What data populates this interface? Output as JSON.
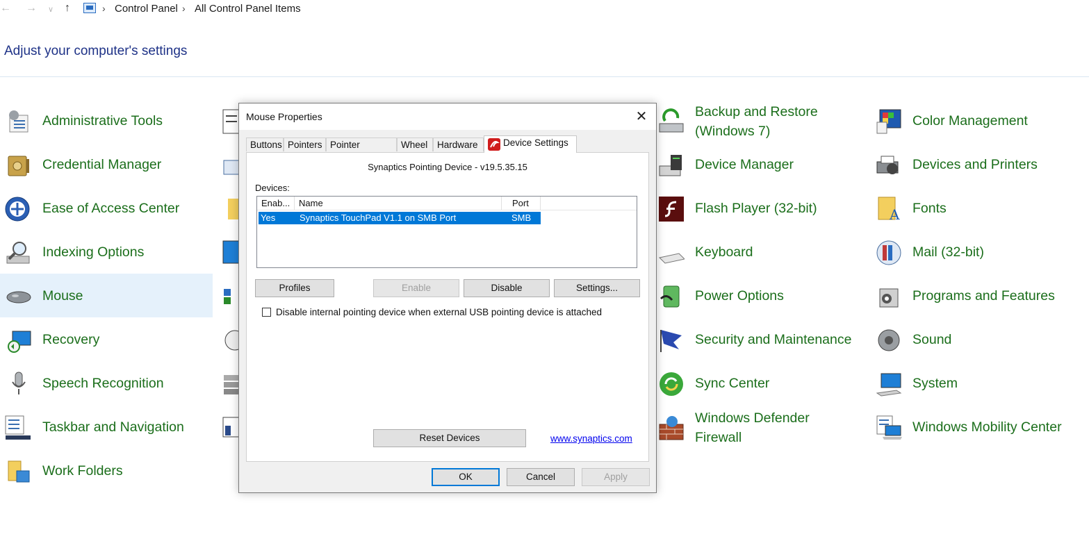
{
  "address": {
    "back": "←",
    "forward": "→",
    "recent": "∨",
    "up": "↑",
    "breadcrumb": [
      "Control Panel",
      "All Control Panel Items"
    ],
    "separator": "›"
  },
  "heading": "Adjust your computer's settings",
  "items": {
    "col1": [
      {
        "label": "Administrative Tools",
        "icon": "admin-tools-icon"
      },
      {
        "label": "Credential Manager",
        "icon": "credential-manager-icon"
      },
      {
        "label": "Ease of Access Center",
        "icon": "ease-of-access-icon"
      },
      {
        "label": "Indexing Options",
        "icon": "indexing-options-icon"
      },
      {
        "label": "Mouse",
        "icon": "mouse-icon",
        "selected": true
      },
      {
        "label": "Recovery",
        "icon": "recovery-icon"
      },
      {
        "label": "Speech Recognition",
        "icon": "microphone-icon"
      },
      {
        "label": "Taskbar and Navigation",
        "icon": "taskbar-icon"
      },
      {
        "label": "Work Folders",
        "icon": "work-folders-icon"
      }
    ],
    "col3": [
      {
        "label1": "Backup and Restore",
        "label2": "(Windows 7)",
        "icon": "backup-restore-icon"
      },
      {
        "label1": "Device Manager",
        "label2": "",
        "icon": "device-manager-icon"
      },
      {
        "label1": "Flash Player (32-bit)",
        "label2": "",
        "icon": "flash-player-icon"
      },
      {
        "label1": "Keyboard",
        "label2": "",
        "icon": "keyboard-icon"
      },
      {
        "label1": "Power Options",
        "label2": "",
        "icon": "power-options-icon"
      },
      {
        "label1": "Security and Maintenance",
        "label2": "",
        "icon": "security-flag-icon"
      },
      {
        "label1": "Sync Center",
        "label2": "",
        "icon": "sync-center-icon"
      },
      {
        "label1": "Windows Defender",
        "label2": "Firewall",
        "icon": "firewall-icon"
      }
    ],
    "col4": [
      {
        "label": "Color Management",
        "icon": "color-management-icon"
      },
      {
        "label": "Devices and Printers",
        "icon": "devices-printers-icon"
      },
      {
        "label": "Fonts",
        "icon": "fonts-icon"
      },
      {
        "label": "Mail (32-bit)",
        "icon": "mail-icon"
      },
      {
        "label": "Programs and Features",
        "icon": "programs-features-icon"
      },
      {
        "label": "Sound",
        "icon": "sound-icon"
      },
      {
        "label": "System",
        "icon": "system-icon"
      },
      {
        "label": "Windows Mobility Center",
        "icon": "mobility-center-icon"
      }
    ]
  },
  "dialog": {
    "title": "Mouse Properties",
    "close": "✕",
    "tabs": [
      "Buttons",
      "Pointers",
      "Pointer Options",
      "Wheel",
      "Hardware",
      "Device Settings"
    ],
    "active_tab": "Device Settings",
    "device_title": "Synaptics Pointing Device - v19.5.35.15",
    "devices_label": "Devices:",
    "columns": [
      "Enab...",
      "Name",
      "Port"
    ],
    "rows": [
      {
        "enabled": "Yes",
        "name": "Synaptics TouchPad V1.1 on SMB Port",
        "port": "SMB"
      }
    ],
    "buttons": {
      "profiles": "Profiles",
      "enable": "Enable",
      "disable": "Disable",
      "settings": "Settings...",
      "reset": "Reset Devices",
      "ok": "OK",
      "cancel": "Cancel",
      "apply": "Apply"
    },
    "checkbox_label": "Disable internal pointing device when external USB pointing device is attached",
    "checkbox_checked": false,
    "link": "www.synaptics.com"
  },
  "colors": {
    "item_text": "#1b6e1b",
    "heading": "#1e3287",
    "selection": "#e5f1fb",
    "accent": "#0078d7"
  }
}
